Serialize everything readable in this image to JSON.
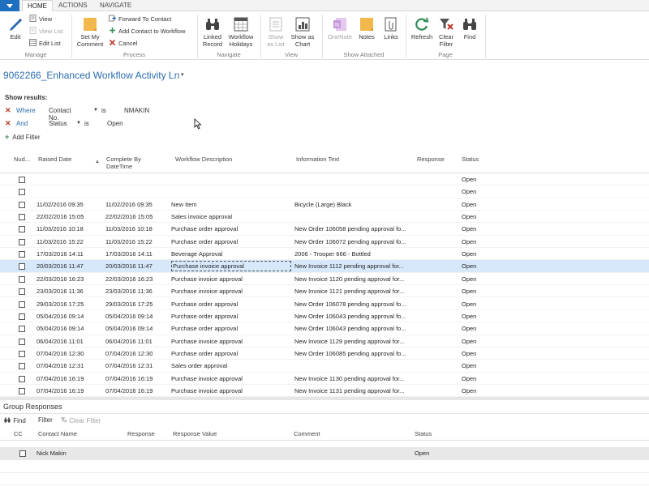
{
  "tabs": {
    "home": "HOME",
    "actions": "ACTIONS",
    "navigate": "NAVIGATE"
  },
  "ribbon": {
    "manage": {
      "label": "Manage",
      "edit": "Edit",
      "view": "View",
      "view_list": "View List",
      "edit_list": "Edit List"
    },
    "process": {
      "label": "Process",
      "set_my_comment": "Set My Comment",
      "forward_to_contact": "Forward To Contact",
      "add_contact_to_workflow": "Add Contact to Workflow",
      "cancel": "Cancel"
    },
    "navigate": {
      "label": "Navigate",
      "linked_record": "Linked Record",
      "workflow_holidays": "Workflow Holidays"
    },
    "view": {
      "label": "View",
      "show_as_list": "Show as List",
      "show_as_chart": "Show as Chart"
    },
    "show_attached": {
      "label": "Show Attached",
      "onenote": "OneNote",
      "notes": "Notes",
      "links": "Links"
    },
    "page": {
      "label": "Page",
      "refresh": "Refresh",
      "clear_filter": "Clear Filter",
      "find": "Find"
    }
  },
  "page": {
    "title": "9062266_Enhanced Workflow Activity Ln",
    "title_caret": "▾"
  },
  "filters": {
    "show_results": "Show results:",
    "rows": [
      {
        "keyword": "Where",
        "field": "Contact No.",
        "operator": "is",
        "value": "NMAKIN"
      },
      {
        "keyword": "And",
        "field": "Status",
        "operator": "is",
        "value": "Open"
      }
    ],
    "add_filter": "Add Filter"
  },
  "grid": {
    "columns": {
      "nud": "Nud...",
      "raised_date": "Raised Date",
      "complete_by": "Complete By DateTime",
      "workflow_description": "Workflow Description",
      "information_text": "Information Text",
      "response": "Response",
      "status": "Status"
    },
    "rows": [
      {
        "raised": "",
        "complete": "",
        "desc": "",
        "info": "",
        "response": "",
        "status": "Open"
      },
      {
        "raised": "",
        "complete": "",
        "desc": "",
        "info": "",
        "response": "",
        "status": "Open"
      },
      {
        "raised": "11/02/2016 09:35",
        "complete": "11/02/2016 09:35",
        "desc": "New Item",
        "info": "Bicycle (Large) Black",
        "response": "",
        "status": "Open"
      },
      {
        "raised": "22/02/2016 15:05",
        "complete": "22/02/2016 15:05",
        "desc": "Sales invoice approval",
        "info": "",
        "response": "",
        "status": "Open"
      },
      {
        "raised": "11/03/2016 10:18",
        "complete": "11/03/2016 10:18",
        "desc": "Purchase order approval",
        "info": "New Order 106058 pending approval fo...",
        "response": "",
        "status": "Open"
      },
      {
        "raised": "11/03/2016 15:22",
        "complete": "11/03/2016 15:22",
        "desc": "Purchase order approval",
        "info": "New Order 106072 pending approval fo...",
        "response": "",
        "status": "Open"
      },
      {
        "raised": "17/03/2016 14:11",
        "complete": "17/03/2016 14:11",
        "desc": "Beverage Approval",
        "info": "2006 - Trooper 666 - Bottled",
        "response": "",
        "status": "Open"
      },
      {
        "raised": "20/03/2016 11:47",
        "complete": "20/03/2016 11:47",
        "desc": "Purchase invoice approval",
        "info": "New Invoice 1112 pending approval for...",
        "response": "",
        "status": "Open"
      },
      {
        "raised": "22/03/2016 16:23",
        "complete": "22/03/2016 16:23",
        "desc": "Purchase invoice approval",
        "info": "New Invoice 1120 pending approval for...",
        "response": "",
        "status": "Open"
      },
      {
        "raised": "23/03/2016 11:36",
        "complete": "23/03/2016 11:36",
        "desc": "Purchase invoice approval",
        "info": "New Invoice 1121 pending approval for...",
        "response": "",
        "status": "Open"
      },
      {
        "raised": "29/03/2016 17:25",
        "complete": "29/03/2016 17:25",
        "desc": "Purchase order approval",
        "info": "New Order 106078 pending approval fo...",
        "response": "",
        "status": "Open"
      },
      {
        "raised": "05/04/2016 09:14",
        "complete": "05/04/2016 09:14",
        "desc": "Purchase order approval",
        "info": "New Order 106043 pending approval fo...",
        "response": "",
        "status": "Open"
      },
      {
        "raised": "05/04/2016 09:14",
        "complete": "05/04/2016 09:14",
        "desc": "Purchase order approval",
        "info": "New Order 106043 pending approval fo...",
        "response": "",
        "status": "Open"
      },
      {
        "raised": "06/04/2016 11:01",
        "complete": "06/04/2016 11:01",
        "desc": "Purchase invoice approval",
        "info": "New Invoice 1129 pending approval for...",
        "response": "",
        "status": "Open"
      },
      {
        "raised": "07/04/2016 12:30",
        "complete": "07/04/2016 12:30",
        "desc": "Purchase order approval",
        "info": "New Order 106085 pending approval fo...",
        "response": "",
        "status": "Open"
      },
      {
        "raised": "07/04/2016 12:31",
        "complete": "07/04/2016 12:31",
        "desc": "Sales order approval",
        "info": "",
        "response": "",
        "status": "Open"
      },
      {
        "raised": "07/04/2016 16:19",
        "complete": "07/04/2016 16:19",
        "desc": "Purchase invoice approval",
        "info": "New Invoice 1130 pending approval for...",
        "response": "",
        "status": "Open"
      },
      {
        "raised": "07/04/2016 16:19",
        "complete": "07/04/2016 16:19",
        "desc": "Purchase invoice approval",
        "info": "New Invoice 1131 pending approval for...",
        "response": "",
        "status": "Open"
      }
    ],
    "selected_row_index": 7
  },
  "group_responses": {
    "title": "Group Responses",
    "toolbar": {
      "find": "Find",
      "filter": "Filter",
      "clear_filter": "Clear Filter"
    },
    "columns": {
      "cc": "CC",
      "contact_name": "Contact Name",
      "response": "Response",
      "response_value": "Response Value",
      "comment": "Comment",
      "status": "Status"
    },
    "rows": [
      {
        "contact_name": "Nick Makin",
        "response": "",
        "response_value": "",
        "comment": "",
        "status": "Open"
      }
    ]
  },
  "colors": {
    "accent_blue": "#1e6fbf",
    "title_blue": "#2b6cb0",
    "selected_row": "#d6e8fa",
    "remove_red": "#c0392b",
    "add_green": "#2e8b57"
  }
}
